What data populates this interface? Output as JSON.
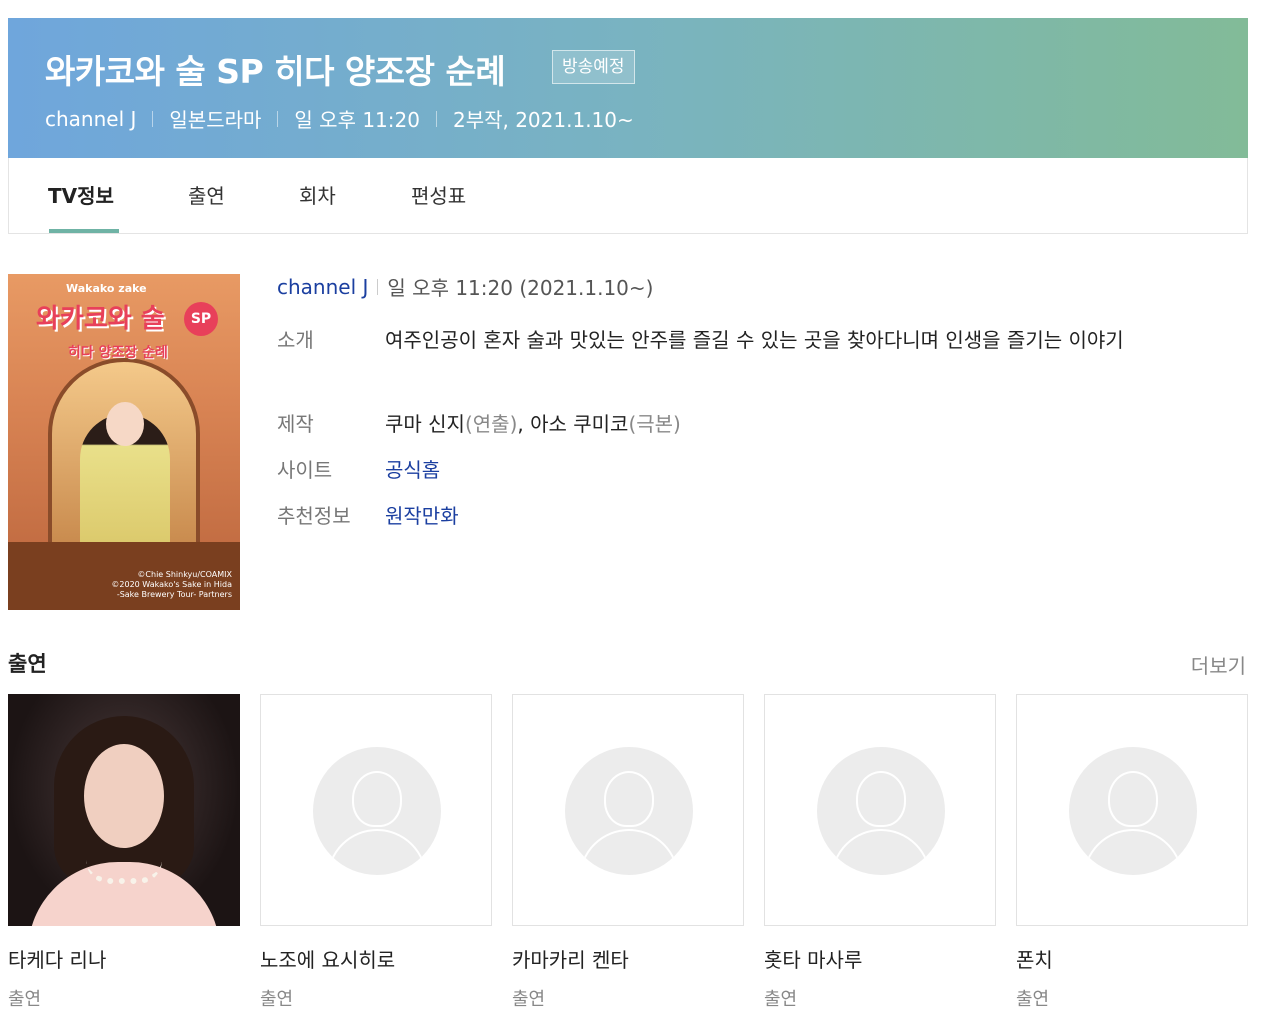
{
  "header": {
    "title": "와카코와 술 SP 히다 양조장 순례",
    "badge": "방송예정",
    "meta": [
      "channel J",
      "일본드라마",
      "일 오후 11:20",
      "2부작, 2021.1.10~"
    ]
  },
  "tabs": [
    {
      "label": "TV정보",
      "active": true
    },
    {
      "label": "출연",
      "active": false
    },
    {
      "label": "회차",
      "active": false
    },
    {
      "label": "편성표",
      "active": false
    }
  ],
  "poster": {
    "logo_en": "Wakako zake",
    "logo_kr": "와카코와 술",
    "logo_sp": "SP",
    "logo_sub": "히다 양조장 순례",
    "credit_lines": [
      "©Chie Shinkyu/COAMIX",
      "©2020 Wakako's Sake in Hida",
      "-Sake Brewery Tour- Partners"
    ]
  },
  "info": {
    "channel": "channel J",
    "schedule": "일 오후 11:20 (2021.1.10~)",
    "rows": {
      "intro": {
        "label": "소개",
        "value": "여주인공이 혼자 술과 맛있는 안주를 즐길 수 있는 곳을 찾아다니며 인생을 즐기는 이야기"
      },
      "production": {
        "label": "제작",
        "person1": "쿠마 신지",
        "role1": "(연출)",
        "separator": ", ",
        "person2": "아소 쿠미코",
        "role2": "(극본)"
      },
      "site": {
        "label": "사이트",
        "value": "공식홈"
      },
      "recommend": {
        "label": "추천정보",
        "value": "원작만화"
      }
    }
  },
  "cast_section": {
    "title": "출연",
    "more": "더보기",
    "members": [
      {
        "name": "타케다 리나",
        "role": "출연",
        "has_photo": true
      },
      {
        "name": "노조에 요시히로",
        "role": "출연",
        "has_photo": false
      },
      {
        "name": "카마카리 켄타",
        "role": "출연",
        "has_photo": false
      },
      {
        "name": "홋타 마사루",
        "role": "출연",
        "has_photo": false
      },
      {
        "name": "폰치",
        "role": "출연",
        "has_photo": false
      }
    ]
  },
  "colors": {
    "banner_start": "#6fa6dc",
    "banner_end": "#82bb98",
    "tab_indicator": "#6fb3a5",
    "link": "#1b3fa0"
  }
}
